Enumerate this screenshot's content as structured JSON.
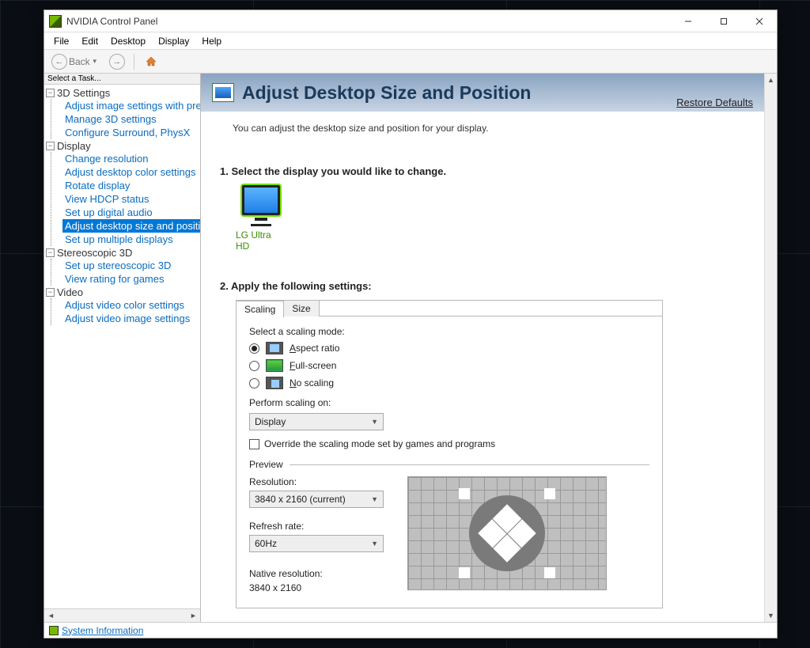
{
  "window": {
    "title": "NVIDIA Control Panel"
  },
  "menu": {
    "file": "File",
    "edit": "Edit",
    "desktop": "Desktop",
    "display": "Display",
    "help": "Help"
  },
  "toolbar": {
    "back": "Back"
  },
  "sidebar": {
    "heading": "Select a Task...",
    "groups": [
      {
        "label": "3D Settings",
        "items": [
          "Adjust image settings with preview",
          "Manage 3D settings",
          "Configure Surround, PhysX"
        ]
      },
      {
        "label": "Display",
        "items": [
          "Change resolution",
          "Adjust desktop color settings",
          "Rotate display",
          "View HDCP status",
          "Set up digital audio",
          "Adjust desktop size and position",
          "Set up multiple displays"
        ],
        "selectedIndex": 5
      },
      {
        "label": "Stereoscopic 3D",
        "items": [
          "Set up stereoscopic 3D",
          "View rating for games"
        ]
      },
      {
        "label": "Video",
        "items": [
          "Adjust video color settings",
          "Adjust video image settings"
        ]
      }
    ]
  },
  "page": {
    "title": "Adjust Desktop Size and Position",
    "restore": "Restore Defaults",
    "intro": "You can adjust the desktop size and position for your display."
  },
  "step1": {
    "heading": "1. Select the display you would like to change.",
    "monitor": "LG Ultra HD"
  },
  "step2": {
    "heading": "2. Apply the following settings:",
    "tabs": {
      "scaling": "Scaling",
      "size": "Size"
    },
    "scaling": {
      "modeLabel": "Select a scaling mode:",
      "options": {
        "aspect": "Aspect ratio",
        "fullscreen": "Full-screen",
        "noscaling": "No scaling"
      },
      "selected": "aspect",
      "performLabel": "Perform scaling on:",
      "performValue": "Display",
      "overrideLabel": "Override the scaling mode set by games and programs",
      "overrideChecked": false,
      "previewLabel": "Preview",
      "resolutionLabel": "Resolution:",
      "resolutionValue": "3840 x 2160 (current)",
      "refreshLabel": "Refresh rate:",
      "refreshValue": "60Hz",
      "nativeLabel": "Native resolution:",
      "nativeValue": "3840 x 2160"
    }
  },
  "status": {
    "sysinfo": "System Information"
  }
}
